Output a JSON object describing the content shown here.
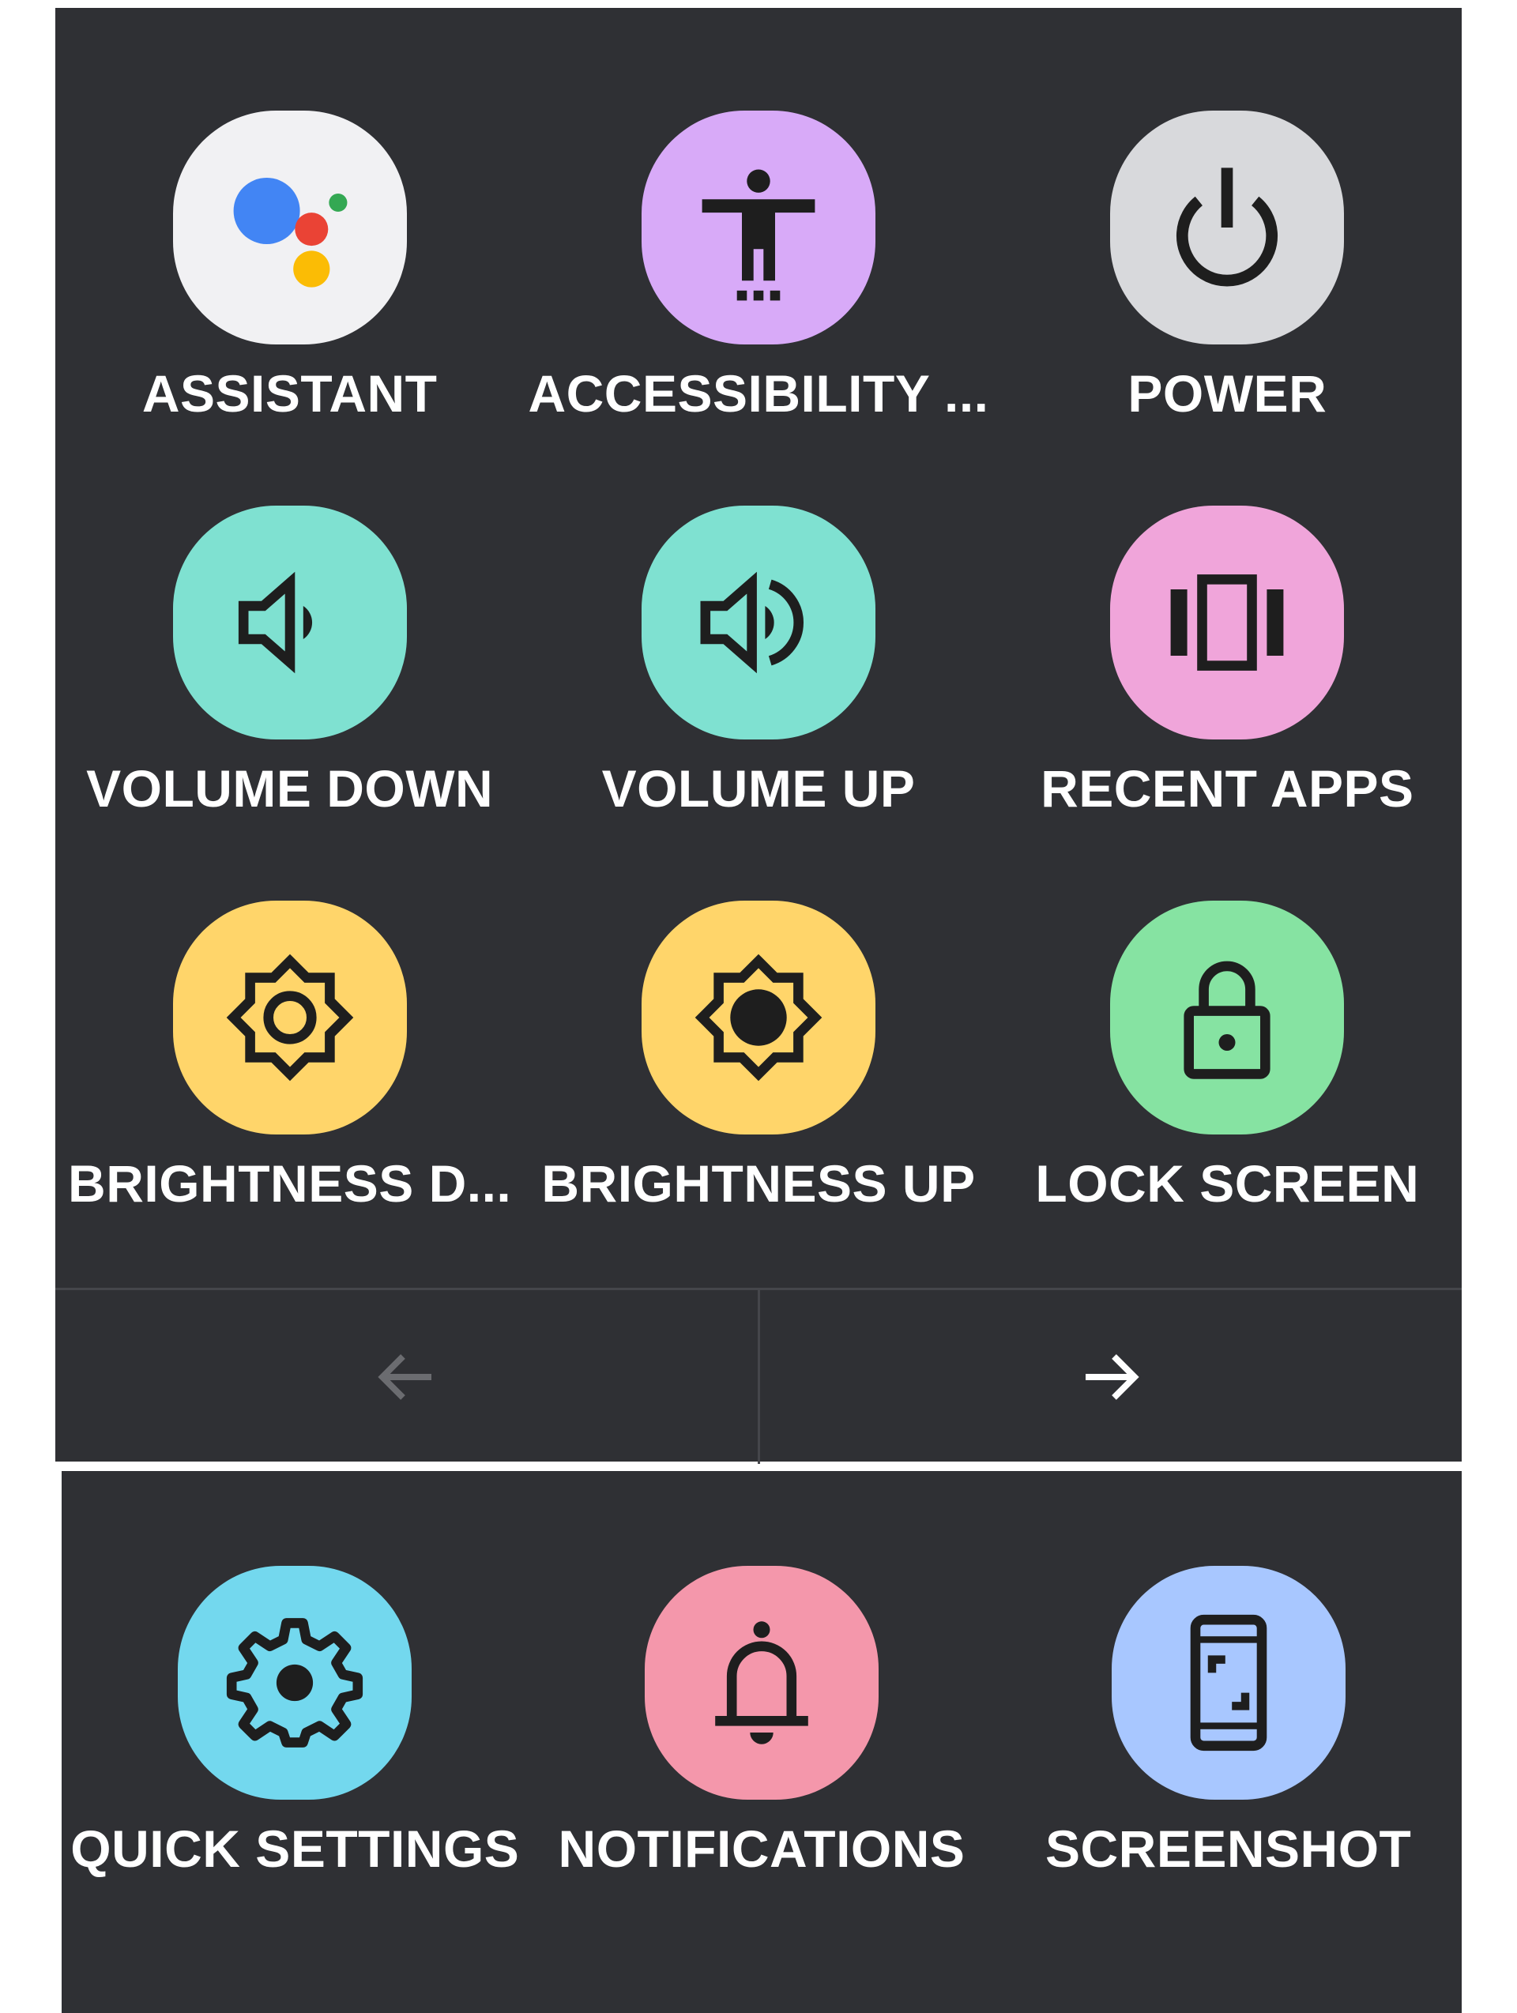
{
  "colors": {
    "panel": "#2f3034",
    "divider": "#45464b",
    "label": "#ffffff",
    "assistant_tile": "#f1f1f3",
    "accessibility_tile": "#d8aaf8",
    "power_tile": "#d8d9dc",
    "volume_tile": "#7fe1d1",
    "recent_apps_tile": "#f0a5da",
    "brightness_tile": "#ffd56a",
    "lock_tile": "#86e3a2",
    "quick_settings_tile": "#73d8ee",
    "notifications_tile": "#f497ab",
    "screenshot_tile": "#a8c7ff",
    "arrow_disabled": "#6b6c70",
    "arrow_enabled": "#ffffff"
  },
  "page1": {
    "items": [
      {
        "label": "ASSISTANT",
        "icon": "assistant-icon"
      },
      {
        "label": "ACCESSIBILITY ...",
        "icon": "accessibility-icon"
      },
      {
        "label": "POWER",
        "icon": "power-icon"
      },
      {
        "label": "VOLUME DOWN",
        "icon": "volume-down-icon"
      },
      {
        "label": "VOLUME UP",
        "icon": "volume-up-icon"
      },
      {
        "label": "RECENT APPS",
        "icon": "recent-apps-icon"
      },
      {
        "label": "BRIGHTNESS D...",
        "icon": "brightness-down-icon"
      },
      {
        "label": "BRIGHTNESS UP",
        "icon": "brightness-up-icon"
      },
      {
        "label": "LOCK SCREEN",
        "icon": "lock-icon"
      }
    ]
  },
  "nav": {
    "previous_icon": "arrow-left-icon",
    "previous_enabled": false,
    "next_icon": "arrow-right-icon",
    "next_enabled": true
  },
  "page2": {
    "items": [
      {
        "label": "QUICK SETTINGS",
        "icon": "gear-icon"
      },
      {
        "label": "NOTIFICATIONS",
        "icon": "bell-icon"
      },
      {
        "label": "SCREENSHOT",
        "icon": "screenshot-icon"
      }
    ]
  }
}
